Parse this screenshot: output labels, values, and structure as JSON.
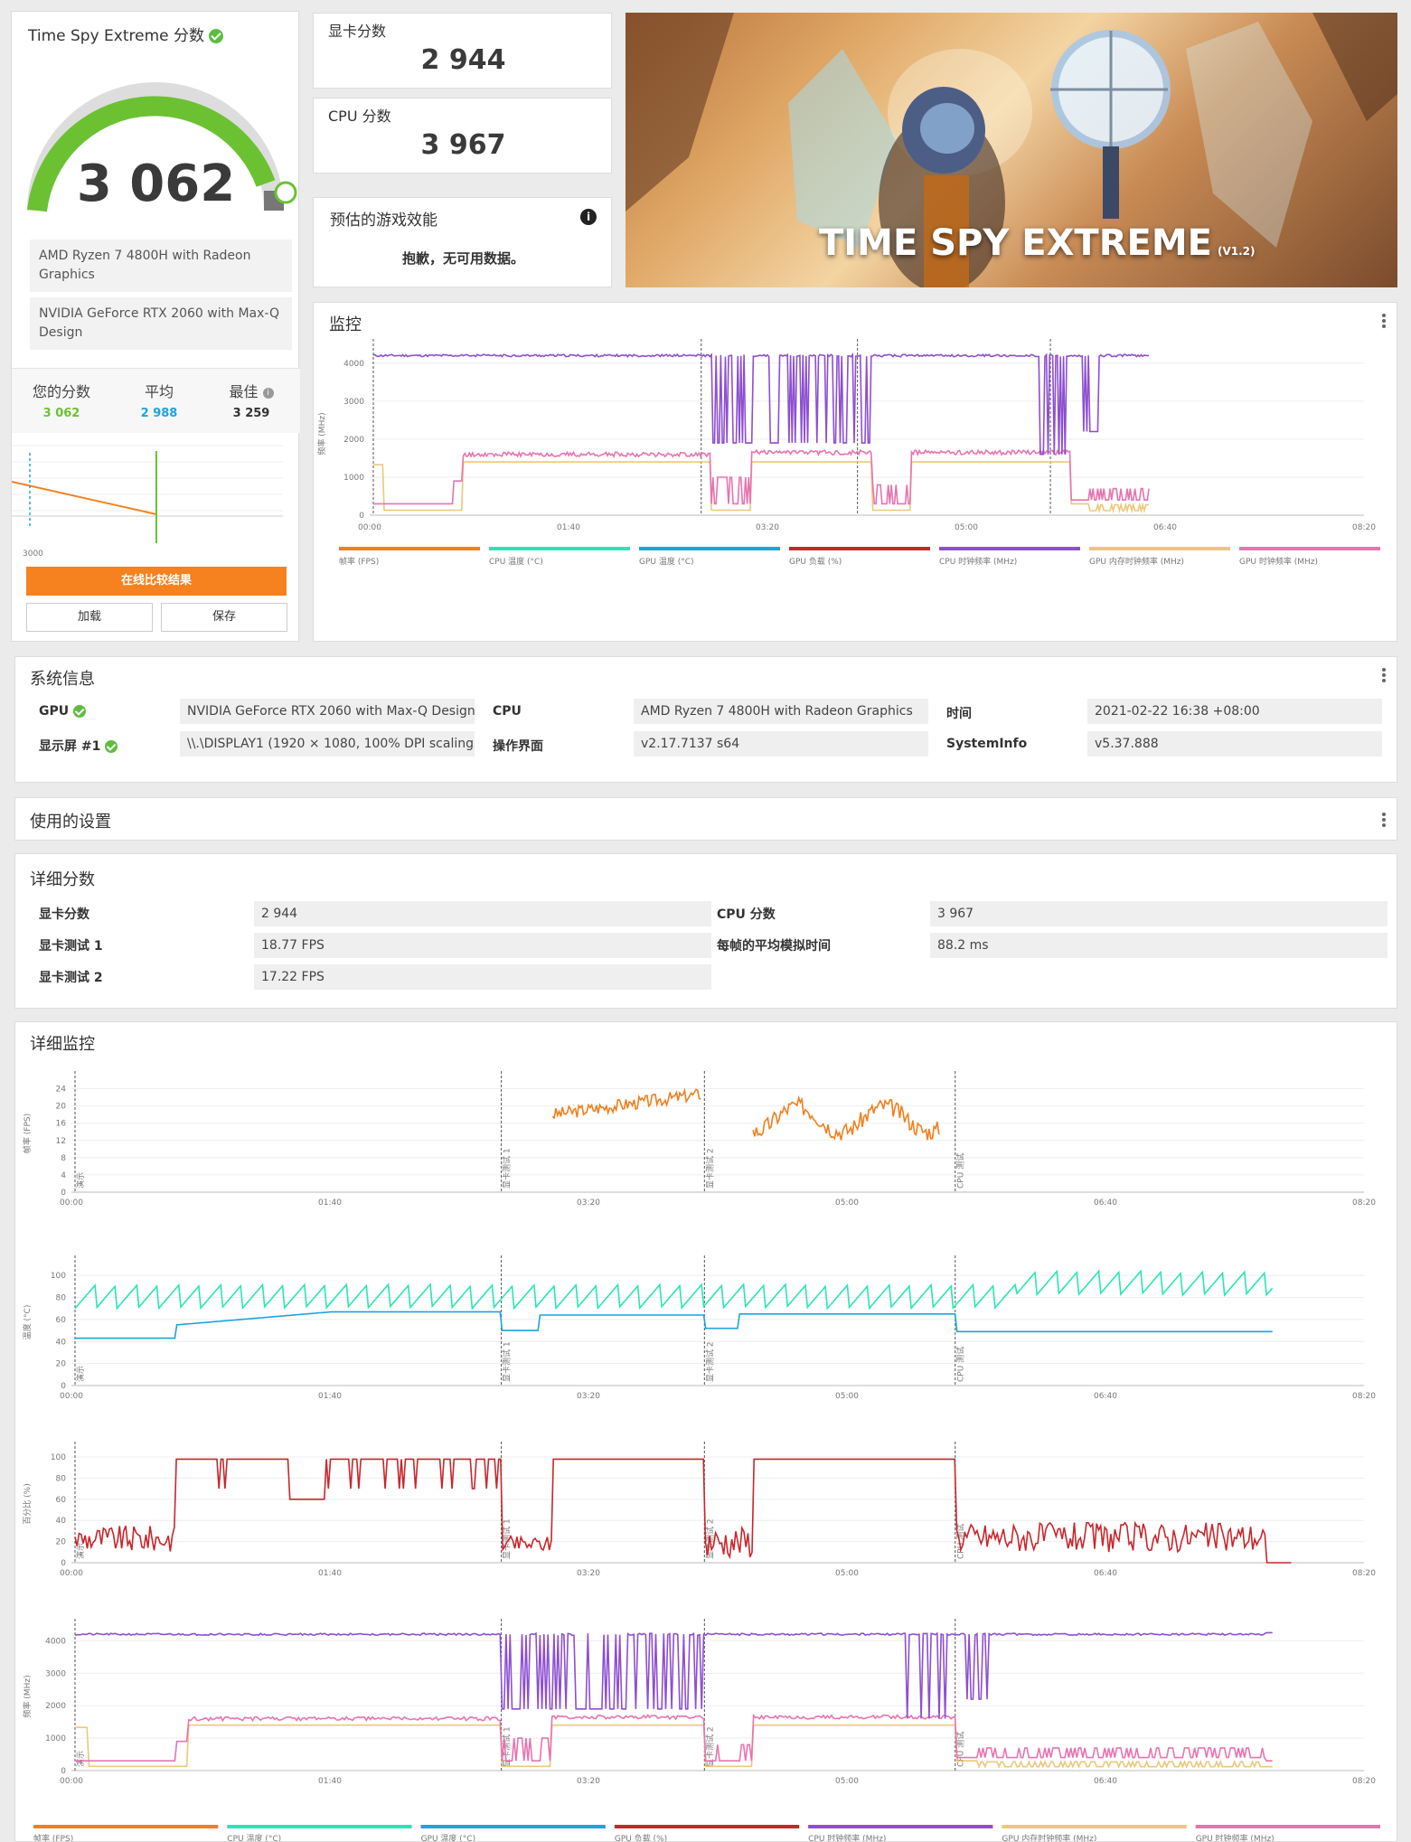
{
  "score_card": {
    "title": "Time Spy Extreme 分数",
    "score": "3 062",
    "hardware": [
      "AMD Ryzen 7 4800H with Radeon Graphics",
      "NVIDIA GeForce RTX 2060 with Max-Q Design"
    ],
    "your_label": "您的分数",
    "your_value": "3 062",
    "avg_label": "平均",
    "avg_value": "2 988",
    "best_label": "最佳",
    "best_value": "3 259",
    "mini_chart_xlabel": "3000",
    "compare_button": "在线比较结果",
    "load_button": "加载",
    "save_button": "保存",
    "colors": {
      "green": "#6cc133",
      "orange": "#f5821f",
      "blue": "#1ea3dc"
    }
  },
  "gpu_score": {
    "label": "显卡分数",
    "value": "2 944"
  },
  "cpu_score": {
    "label": "CPU 分数",
    "value": "3 967"
  },
  "game_perf": {
    "title": "预估的游戏效能",
    "message": "抱歉，无可用数据。"
  },
  "banner": {
    "title": "TIME SPY EXTREME",
    "version": "(V1.2)"
  },
  "monitor": {
    "title": "监控",
    "ylabel": "频率 (MHz)",
    "x_ticks": [
      "00:00",
      "01:40",
      "03:20",
      "05:00",
      "06:40",
      "08:20"
    ],
    "y_ticks": [
      "0",
      "1000",
      "2000",
      "3000",
      "4000"
    ],
    "legend": [
      {
        "name": "帧率 (FPS)",
        "color": "#f07f1d"
      },
      {
        "name": "CPU 温度 (°C)",
        "color": "#28e6b4"
      },
      {
        "name": "GPU 温度 (°C)",
        "color": "#1ea3dc"
      },
      {
        "name": "GPU 负载 (%)",
        "color": "#c8262c"
      },
      {
        "name": "CPU 时钟频率 (MHz)",
        "color": "#8d4fd1"
      },
      {
        "name": "GPU 内存时钟频率 (MHz)",
        "color": "#ecc879"
      },
      {
        "name": "GPU 时钟频率 (MHz)",
        "color": "#e873b1"
      }
    ]
  },
  "sysinfo": {
    "title": "系统信息",
    "gpu_label": "GPU",
    "gpu_value": "NVIDIA GeForce RTX 2060 with Max-Q Design",
    "display_label": "显示屏 #1",
    "display_value": "\\\\.\\DISPLAY1 (1920 × 1080, 100% DPI scaling)",
    "cpu_label": "CPU",
    "cpu_value": "AMD Ryzen 7 4800H with Radeon Graphics",
    "os_label": "操作界面",
    "os_value": "v2.17.7137 s64",
    "time_label": "时间",
    "time_value": "2021-02-22 16:38 +08:00",
    "si_label": "SystemInfo",
    "si_value": "v5.37.888"
  },
  "settings": {
    "title": "使用的设置"
  },
  "detail_scores": {
    "title": "详细分数",
    "rows_left": [
      {
        "label": "显卡分数",
        "value": "2 944"
      },
      {
        "label": "显卡测试 1",
        "value": "18.77 FPS"
      },
      {
        "label": "显卡测试 2",
        "value": "17.22 FPS"
      }
    ],
    "rows_right": [
      {
        "label": "CPU 分数",
        "value": "3 967"
      },
      {
        "label": "每帧的平均模拟时间",
        "value": "88.2 ms"
      }
    ]
  },
  "detail_monitor": {
    "title": "详细监控",
    "x_ticks": [
      "00:00",
      "01:40",
      "03:20",
      "05:00",
      "06:40",
      "08:20"
    ],
    "section_labels": [
      "演示",
      "显卡测试 1",
      "显卡测试 2",
      "CPU 测试"
    ],
    "fps_ylabel": "帧率 (FPS)",
    "fps_ticks": [
      "0",
      "4",
      "8",
      "12",
      "16",
      "20",
      "24"
    ],
    "temp_ylabel": "温度 (°C)",
    "temp_ticks": [
      "0",
      "20",
      "40",
      "60",
      "80",
      "100"
    ],
    "pct_ylabel": "百分比 (%)",
    "pct_ticks": [
      "0",
      "20",
      "40",
      "60",
      "80",
      "100"
    ],
    "freq_ylabel": "频率 (MHz)",
    "freq_ticks": [
      "0",
      "1000",
      "2000",
      "3000",
      "4000"
    ]
  }
}
